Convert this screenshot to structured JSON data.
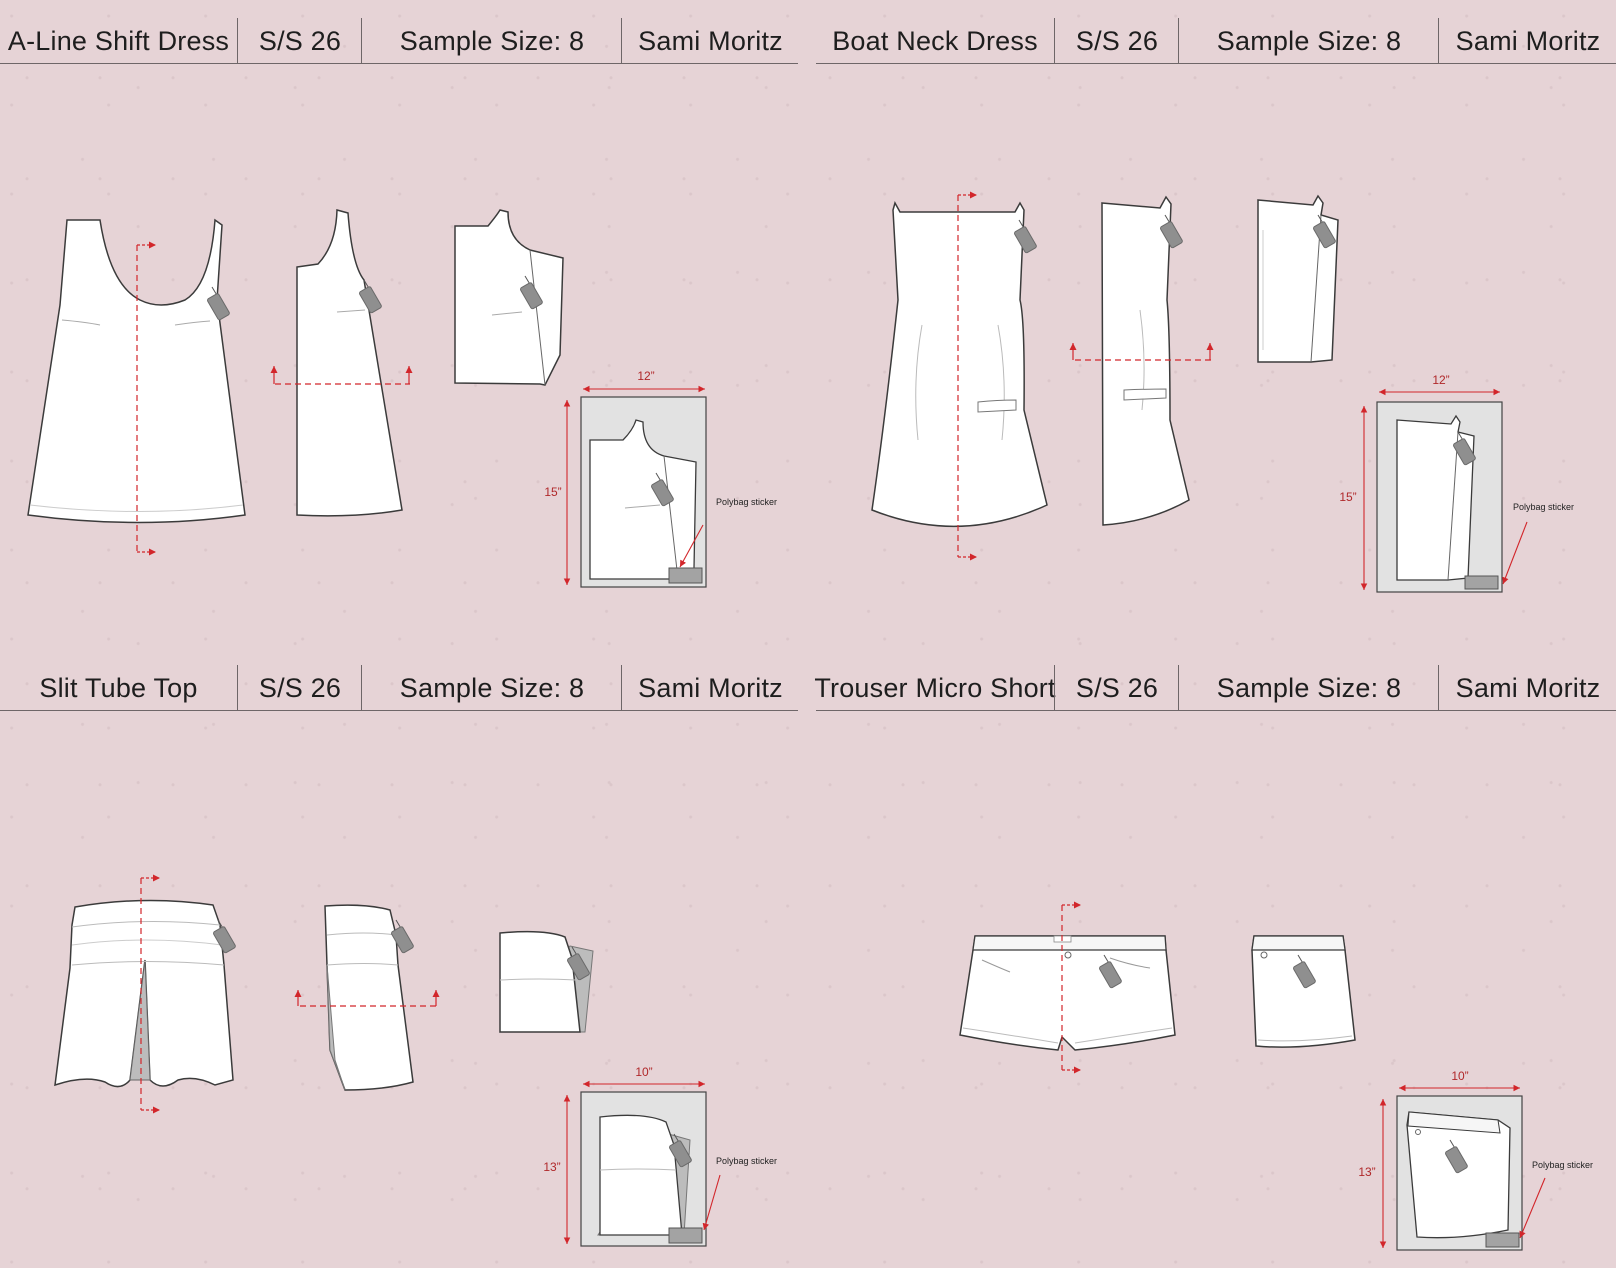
{
  "season": "S/S 26",
  "sample_size": "Sample Size: 8",
  "designer": "Sami Moritz",
  "sticker_label": "Polybag sticker",
  "accent_color": "#d2262b",
  "garments": [
    {
      "name": "A-Line Shift Dress",
      "width": "12”",
      "height": "15”"
    },
    {
      "name": "Boat Neck Dress",
      "width": "12”",
      "height": "15”"
    },
    {
      "name": "Slit Tube Top",
      "width": "10”",
      "height": "13”"
    },
    {
      "name": "Trouser Micro Short",
      "width": "10”",
      "height": "13”"
    }
  ]
}
